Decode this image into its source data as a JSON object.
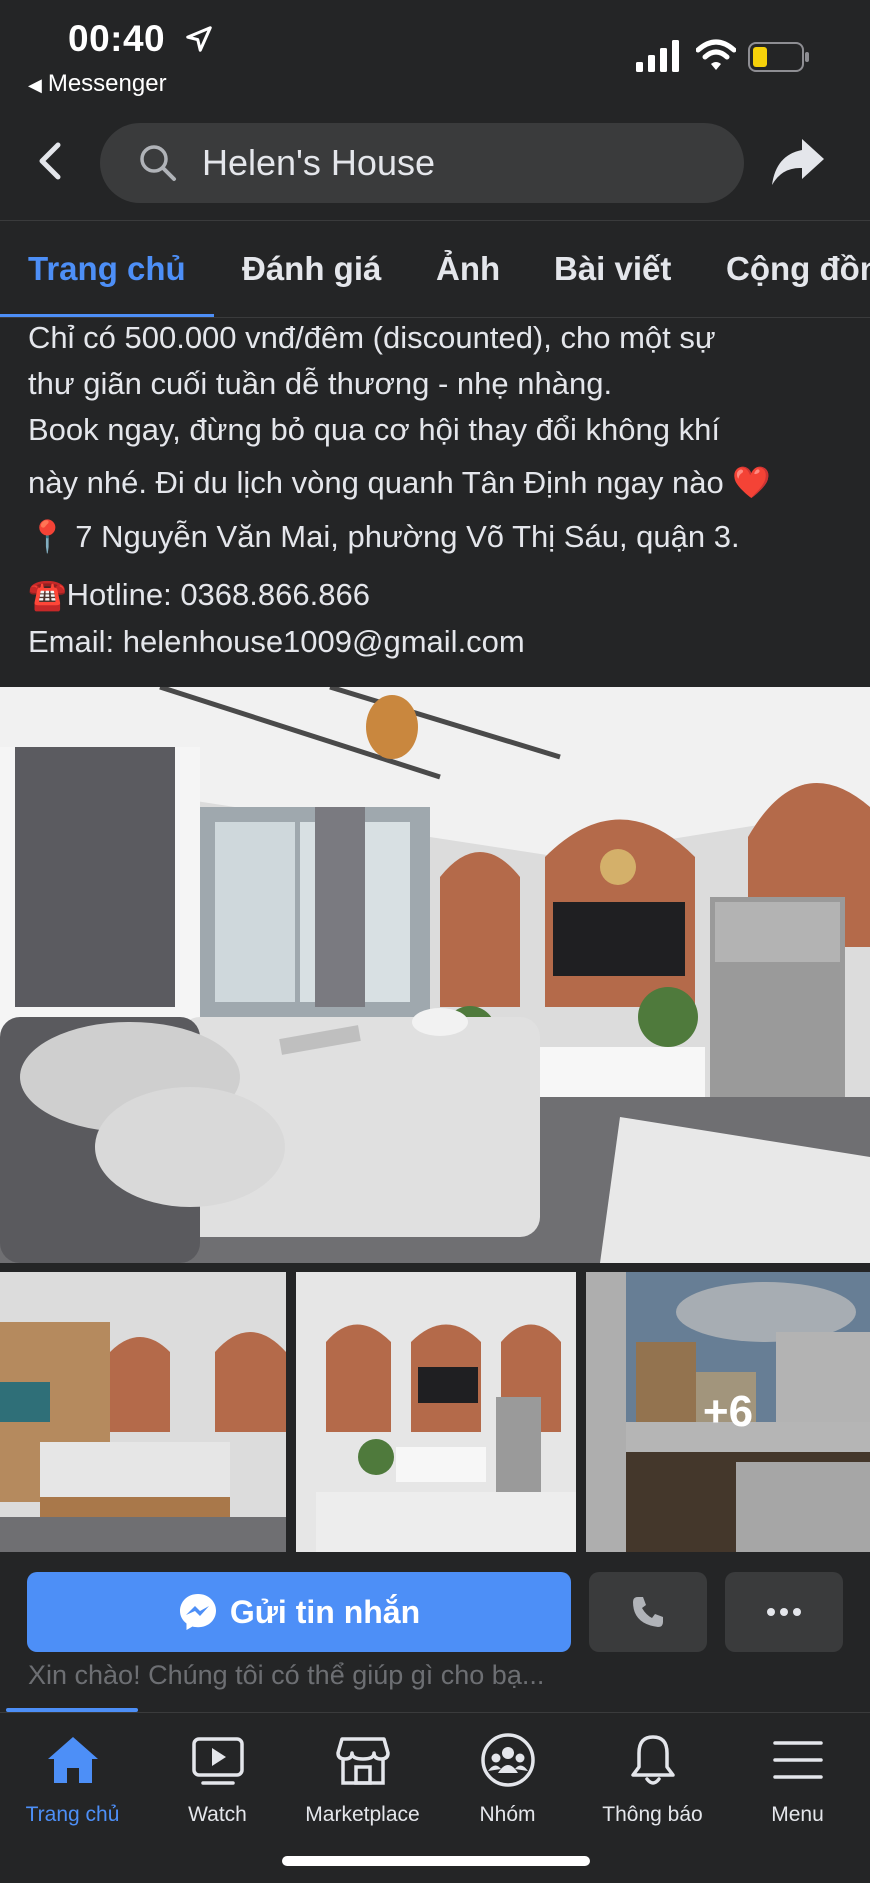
{
  "status_bar": {
    "time": "00:40",
    "back_app": "Messenger"
  },
  "header": {
    "search_text": "Helen's House"
  },
  "tabs": [
    {
      "label": "Trang chủ"
    },
    {
      "label": "Đánh giá"
    },
    {
      "label": "Ảnh"
    },
    {
      "label": "Bài viết"
    },
    {
      "label": "Cộng đồng"
    }
  ],
  "post": {
    "lines": [
      "Chỉ có 500.000 vnđ/đêm (discounted), cho một sự",
      "thư giãn cuối tuần dễ thương - nhẹ nhàng.",
      "Book ngay, đừng bỏ qua cơ hội thay đổi không khí",
      "này nhé. Đi du lịch vòng quanh Tân Định ngay nào ❤️",
      "📍 7 Nguyễn Văn Mai, phường Võ Thị Sáu, quận 3.",
      "☎️Hotline: 0368.866.866",
      "Email: helenhouse1009@gmail.com"
    ],
    "more_photos": "+6"
  },
  "actions": {
    "message_label": "Gửi tin nhắn",
    "greeting": "Xin chào! Chúng tôi có thể giúp gì cho bạ..."
  },
  "bottom_nav": [
    {
      "label": "Trang chủ",
      "icon": "home-icon"
    },
    {
      "label": "Watch",
      "icon": "watch-icon"
    },
    {
      "label": "Marketplace",
      "icon": "marketplace-icon"
    },
    {
      "label": "Nhóm",
      "icon": "groups-icon"
    },
    {
      "label": "Thông báo",
      "icon": "bell-icon"
    },
    {
      "label": "Menu",
      "icon": "menu-icon"
    }
  ],
  "colors": {
    "accent": "#4d8ff7",
    "background": "#242526",
    "surface": "#3a3b3c"
  }
}
